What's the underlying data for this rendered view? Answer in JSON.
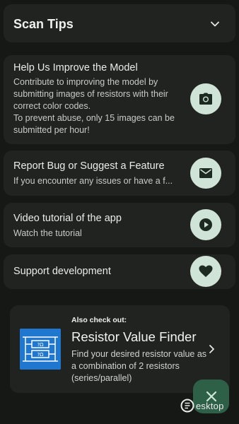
{
  "scan_tips": {
    "title": "Scan Tips",
    "icon": "chevron-down-icon"
  },
  "improve_card": {
    "title": "Help Us Improve the Model",
    "body_line1": "Contribute to improving the model by submitting images of resistors with their correct color codes.",
    "body_line2": "To prevent abuse, only 15 images can be submitted per hour!",
    "icon": "camera-icon"
  },
  "bug_card": {
    "title": "Report Bug or Suggest a Feature",
    "body": "If you encounter any issues or have a f...",
    "icon": "mail-icon"
  },
  "video_card": {
    "title": "Video tutorial of the app",
    "body": "Watch the tutorial",
    "icon": "play-circle-icon"
  },
  "support_card": {
    "title": "Support development",
    "icon": "heart-icon"
  },
  "promo": {
    "kicker": "Also check out:",
    "app_name": "Resistor Value Finder",
    "description": "Find your desired resistor value as a combination of 2 resistors (series/parallel)",
    "logo_label_top": "?Ω",
    "logo_label_bottom": "?Ω",
    "icon": "chevron-right-icon"
  },
  "fab": {
    "icon": "close-icon"
  },
  "watermark": {
    "text": "esktop"
  },
  "colors": {
    "background": "#161816",
    "card": "#202320",
    "button": "#cfe4d6",
    "fab": "#2e6048",
    "promo_logo": "#1f77d0"
  }
}
